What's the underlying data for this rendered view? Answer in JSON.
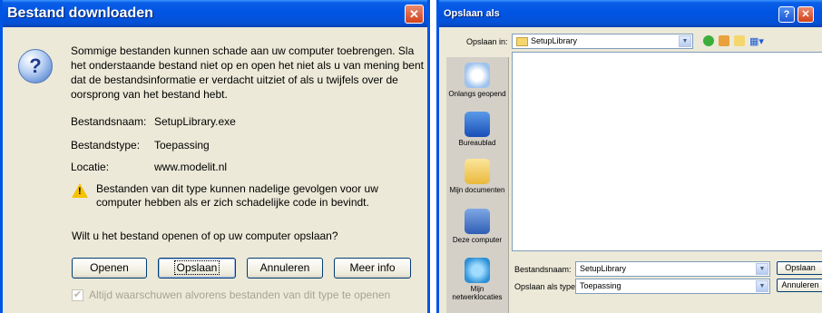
{
  "download_dialog": {
    "title": "Bestand downloaden",
    "close_glyph": "✕",
    "question_glyph": "?",
    "message": "Sommige bestanden kunnen schade aan uw computer toebrengen. Sla het onderstaande bestand niet op en open het niet als u van mening bent dat de bestandsinformatie er verdacht uitziet of als u twijfels over de oorsprong van het bestand hebt.",
    "fields": {
      "name_label": "Bestandsnaam:",
      "name_value": "SetupLibrary.exe",
      "type_label": "Bestandstype:",
      "type_value": "Toepassing",
      "location_label": "Locatie:",
      "location_value": "www.modelit.nl"
    },
    "warning": "Bestanden van dit type kunnen nadelige gevolgen voor uw computer hebben als er zich schadelijke code in bevindt.",
    "question": "Wilt u het bestand openen of op uw computer opslaan?",
    "buttons": {
      "open": "Openen",
      "save": "Opslaan",
      "cancel": "Annuleren",
      "more": "Meer info"
    },
    "always_warn": {
      "label": "Altijd waarschuwen alvorens bestanden van dit type te openen",
      "checked": true,
      "disabled": true
    }
  },
  "save_dialog": {
    "title": "Opslaan als",
    "help_glyph": "?",
    "close_glyph": "✕",
    "save_in_label": "Opslaan in:",
    "save_in_value": "SetupLibrary",
    "places": [
      "Onlangs geopend",
      "Bureaublad",
      "Mijn documenten",
      "Deze computer",
      "Mijn netwerklocaties"
    ],
    "filename_label": "Bestandsnaam:",
    "filename_value": "SetupLibrary",
    "filetype_label": "Opslaan als type:",
    "filetype_value": "Toepassing",
    "save_button": "Opslaan",
    "cancel_button": "Annuleren",
    "dropdown_glyph": "▼",
    "views_glyph": "▦▾"
  },
  "colors": {
    "titlebar": "#0054e3",
    "dialog_bg": "#ece9d8",
    "close": "#d2421b",
    "warning": "#f6c200"
  }
}
